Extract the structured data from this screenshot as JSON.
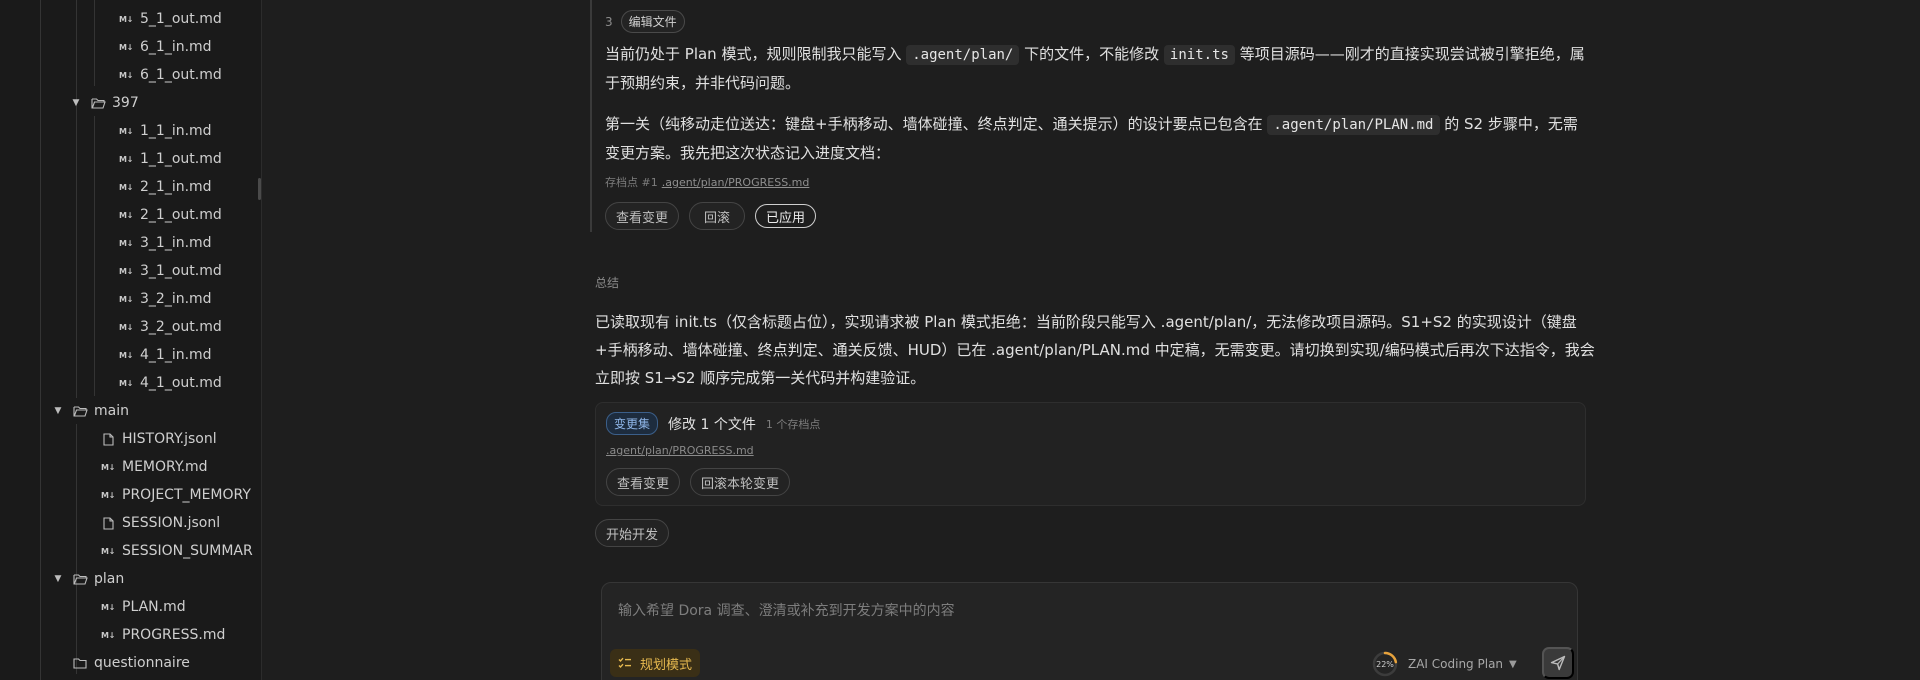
{
  "sidebar": {
    "tree": [
      {
        "label": "5_1_out.md",
        "kind": "md"
      },
      {
        "label": "6_1_in.md",
        "kind": "md"
      },
      {
        "label": "6_1_out.md",
        "kind": "md"
      },
      {
        "label": "397",
        "kind": "folder"
      },
      {
        "label": "1_1_in.md",
        "kind": "md"
      },
      {
        "label": "1_1_out.md",
        "kind": "md"
      },
      {
        "label": "2_1_in.md",
        "kind": "md"
      },
      {
        "label": "2_1_out.md",
        "kind": "md"
      },
      {
        "label": "3_1_in.md",
        "kind": "md"
      },
      {
        "label": "3_1_out.md",
        "kind": "md"
      },
      {
        "label": "3_2_in.md",
        "kind": "md"
      },
      {
        "label": "3_2_out.md",
        "kind": "md"
      },
      {
        "label": "4_1_in.md",
        "kind": "md"
      },
      {
        "label": "4_1_out.md",
        "kind": "md"
      },
      {
        "label": "main",
        "kind": "folder"
      },
      {
        "label": "HISTORY.jsonl",
        "kind": "file"
      },
      {
        "label": "MEMORY.md",
        "kind": "md"
      },
      {
        "label": "PROJECT_MEMORY",
        "kind": "md"
      },
      {
        "label": "SESSION.jsonl",
        "kind": "file"
      },
      {
        "label": "SESSION_SUMMAR",
        "kind": "md"
      },
      {
        "label": "plan",
        "kind": "folder"
      },
      {
        "label": "PLAN.md",
        "kind": "md"
      },
      {
        "label": "PROGRESS.md",
        "kind": "md"
      },
      {
        "label": "questionnaire",
        "kind": "folder-closed"
      }
    ]
  },
  "tool_step": {
    "number": "3",
    "tag": "编辑文件",
    "para1": {
      "t1": "当前仍处于 Plan 模式，规则限制我只能写入 ",
      "c1": ".agent/plan/",
      "t2": " 下的文件，不能修改 ",
      "c2": "init.ts",
      "t3": " 等项目源码——刚才的直接实现尝试被引擎拒绝，属于预期约束，并非代码问题。"
    },
    "para2": {
      "t1": "第一关（纯移动走位送达：键盘+手柄移动、墙体碰撞、终点判定、通关提示）的设计要点已包含在 ",
      "c1": ".agent/plan/PLAN.md",
      "t2": " 的 S2 步骤中，无需变更方案。我先把这次状态记入进度文档："
    },
    "checkpoint_label": "存档点 #1",
    "checkpoint_file": ".agent/plan/PROGRESS.md",
    "buttons": {
      "view_changes": "查看变更",
      "rollback": "回滚",
      "applied": "已应用"
    }
  },
  "summary": {
    "label": "总结",
    "text": "已读取现有 init.ts（仅含标题占位），实现请求被 Plan 模式拒绝：当前阶段只能写入 .agent/plan/，无法修改项目源码。S1+S2 的实现设计（键盘+手柄移动、墙体碰撞、终点判定、通关反馈、HUD）已在 .agent/plan/PLAN.md 中定稿，无需变更。请切换到实现/编码模式后再次下达指令，我会立即按 S1→S2 顺序完成第一关代码并构建验证。"
  },
  "changeset": {
    "badge": "变更集",
    "title": "修改 1 个文件",
    "count": "1 个存档点",
    "file": ".agent/plan/PROGRESS.md",
    "view_changes": "查看变更",
    "rollback_round": "回滚本轮变更"
  },
  "start_dev": "开始开发",
  "composer": {
    "placeholder": "输入希望 Dora 调查、澄清或补充到开发方案中的内容",
    "mode": "规划模式",
    "usage_percent": 22,
    "usage_label": "22%",
    "plan_name": "ZAI Coding Plan"
  },
  "colors": {
    "accent_amber": "#e6b94f",
    "badge_blue": "#8fb6e8",
    "usage_ring": "#e6a23c"
  }
}
